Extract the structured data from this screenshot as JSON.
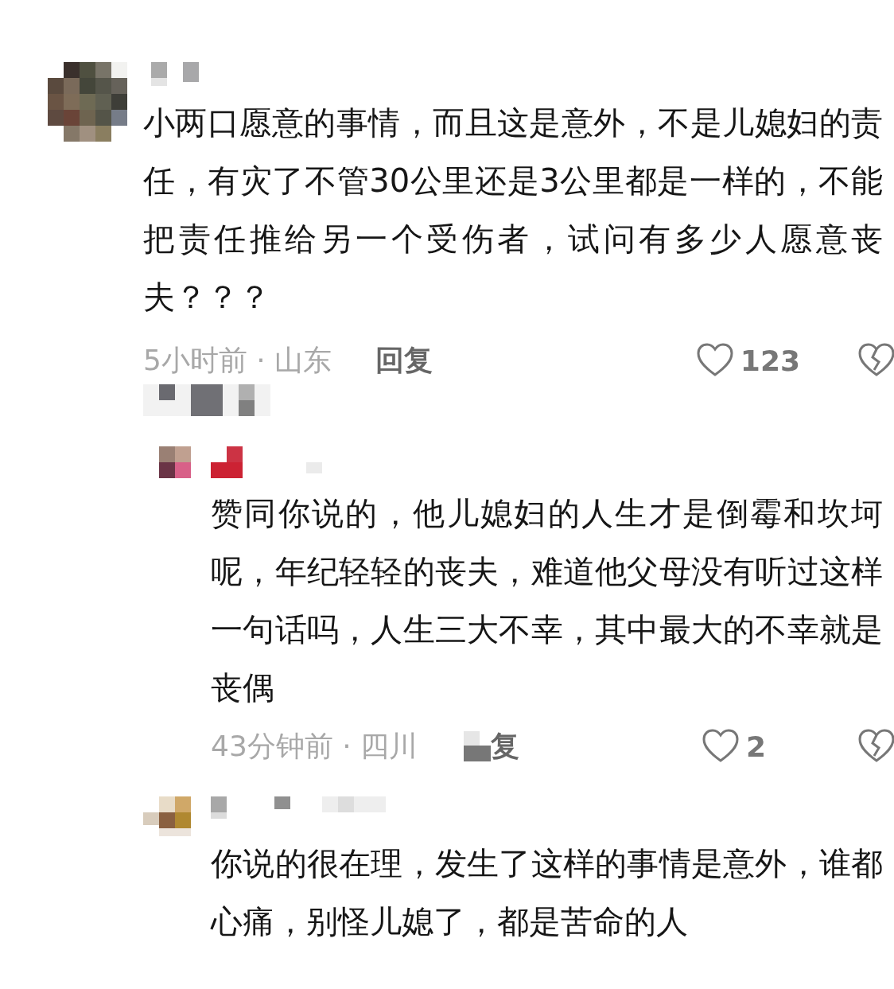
{
  "comments": [
    {
      "text": "小两口愿意的事情，而且这是意外，不是儿媳妇的责任，有灾了不管30公里还是3公里都是一样的，不能把责任推给另一个受伤者，试问有多少人愿意丧夫？？？",
      "time_location": "5小时前 · 山东",
      "reply_label": "回复",
      "likes": "123",
      "replies": [
        {
          "text": "赞同你说的，他儿媳妇的人生才是倒霉和坎坷呢，年纪轻轻的丧夫，难道他父母没有听过这样一句话吗，人生三大不幸，其中最大的不幸就是丧偶",
          "time_location": "43分钟前 · 四川",
          "reply_label": "复",
          "likes": "2"
        },
        {
          "text": "你说的很在理，发生了这样的事情是意外，谁都心痛，别怪儿媳了，都是苦命的人"
        }
      ]
    }
  ]
}
